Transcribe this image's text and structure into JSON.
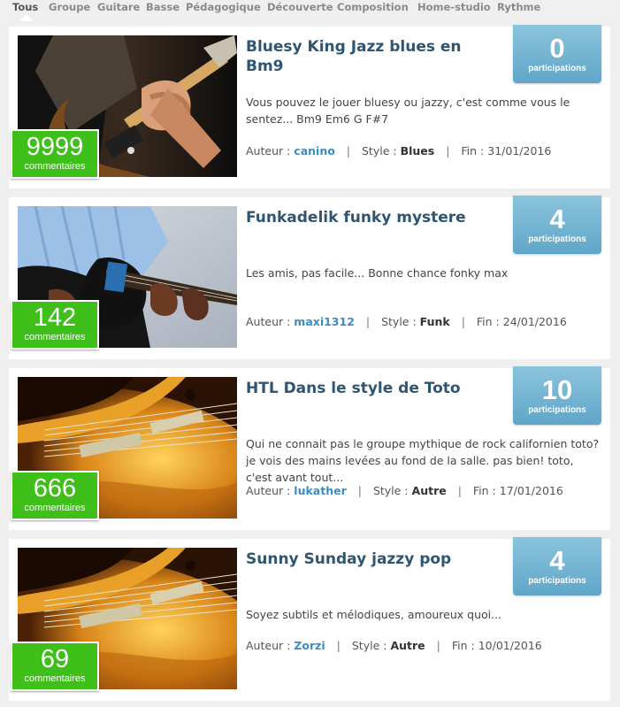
{
  "tabs": [
    {
      "label": "Tous",
      "active": true
    },
    {
      "label": "Groupe"
    },
    {
      "label": "Guitare"
    },
    {
      "label": "Basse"
    },
    {
      "label": "Pédagogique"
    },
    {
      "label": "Découverte"
    },
    {
      "label": "Composition"
    },
    {
      "label": "Home-studio"
    },
    {
      "label": "Rythme"
    }
  ],
  "labels": {
    "participations": "participations",
    "commentaires": "commentaires",
    "author": "Auteur :",
    "style": "Style :",
    "end": "Fin :",
    "separator": "|"
  },
  "colors": {
    "comments_green": "#3fbf1a",
    "badge_blue": "#6aaecf",
    "title": "#2f5570",
    "author_link": "#3a8ec2"
  },
  "entries": [
    {
      "title": "Bluesy King Jazz blues en Bm9",
      "participations": "0",
      "comments": "9999",
      "description": "Vous pouvez le jouer bluesy ou jazzy, c'est comme vous le sentez... Bm9 Em6 G F#7",
      "author": "canino",
      "style": "Blues",
      "end_date": "31/01/2016",
      "image": "electric-guitar-photo"
    },
    {
      "title": "Funkadelik funky mystere",
      "participations": "4",
      "comments": "142",
      "description": "Les amis, pas facile... Bonne chance fonky max",
      "author": "maxi1312",
      "style": "Funk",
      "end_date": "24/01/2016",
      "image": "guitarist-blue-shirt-photo"
    },
    {
      "title": "HTL Dans le style de Toto",
      "participations": "10",
      "comments": "666",
      "description": "Qui ne connait pas le groupe mythique de rock californien toto? je vois des mains levées au fond de la salle. pas bien! toto, c'est avant tout...",
      "author": "lukather",
      "style": "Autre",
      "end_date": "17/01/2016",
      "image": "sunburst-guitar-photo"
    },
    {
      "title": "Sunny Sunday jazzy pop",
      "participations": "4",
      "comments": "69",
      "description": "Soyez subtils et mélodiques, amoureux quoi...",
      "author": "Zorzi",
      "style": "Autre",
      "end_date": "10/01/2016",
      "image": "sunburst-guitar-photo"
    }
  ]
}
